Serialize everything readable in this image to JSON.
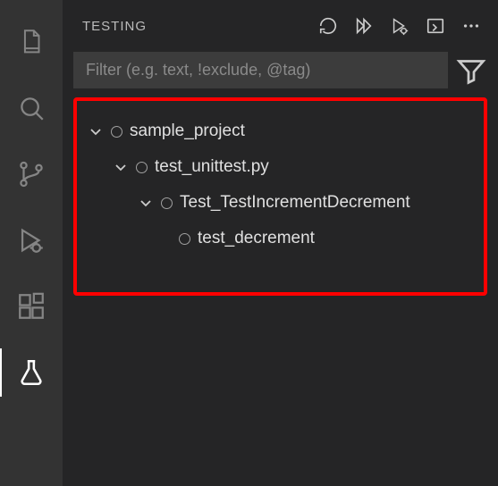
{
  "panel": {
    "title": "TESTING",
    "filter_placeholder": "Filter (e.g. text, !exclude, @tag)"
  },
  "activity": {
    "items": [
      {
        "name": "explorer"
      },
      {
        "name": "search"
      },
      {
        "name": "source-control"
      },
      {
        "name": "run-debug"
      },
      {
        "name": "extensions"
      },
      {
        "name": "testing",
        "active": true
      }
    ]
  },
  "header_actions": [
    {
      "name": "refresh"
    },
    {
      "name": "run-all"
    },
    {
      "name": "debug-all"
    },
    {
      "name": "show-output"
    },
    {
      "name": "more"
    }
  ],
  "tree": {
    "r0": {
      "label": "sample_project"
    },
    "r1": {
      "label": "test_unittest.py"
    },
    "r2": {
      "label": "Test_TestIncrementDecrement"
    },
    "r3": {
      "label": "test_decrement"
    }
  }
}
